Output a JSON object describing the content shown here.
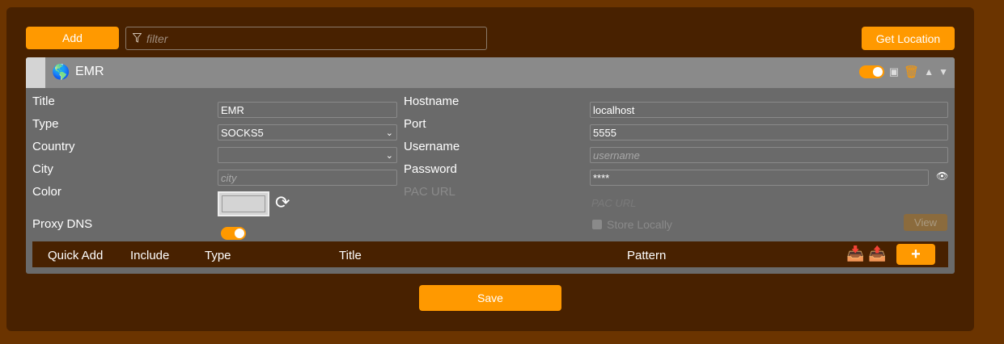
{
  "toolbar": {
    "add_label": "Add",
    "filter_placeholder": "filter",
    "get_location_label": "Get Location"
  },
  "proxy": {
    "header_title": "EMR",
    "swatch_color": "#d4d4d4",
    "enabled": true,
    "fields": {
      "title_label": "Title",
      "title_value": "EMR",
      "type_label": "Type",
      "type_value": "SOCKS5",
      "country_label": "Country",
      "country_value": "",
      "city_label": "City",
      "city_placeholder": "city",
      "color_label": "Color",
      "proxy_dns_label": "Proxy DNS",
      "hostname_label": "Hostname",
      "hostname_value": "localhost",
      "port_label": "Port",
      "port_value": "5555",
      "username_label": "Username",
      "username_placeholder": "username",
      "password_label": "Password",
      "password_value": "****",
      "pac_url_label": "PAC URL",
      "pac_url_placeholder": "PAC URL",
      "store_locally_label": "Store Locally",
      "view_label": "View"
    },
    "patterns": {
      "columns": [
        "Quick Add",
        "Include",
        "Type",
        "Title",
        "Pattern"
      ],
      "add_label": "+"
    }
  },
  "footer": {
    "save_label": "Save"
  },
  "colors": {
    "accent": "#ff9900",
    "background": "#6b3400",
    "panel": "#482100",
    "card": "#6a6a6a"
  }
}
